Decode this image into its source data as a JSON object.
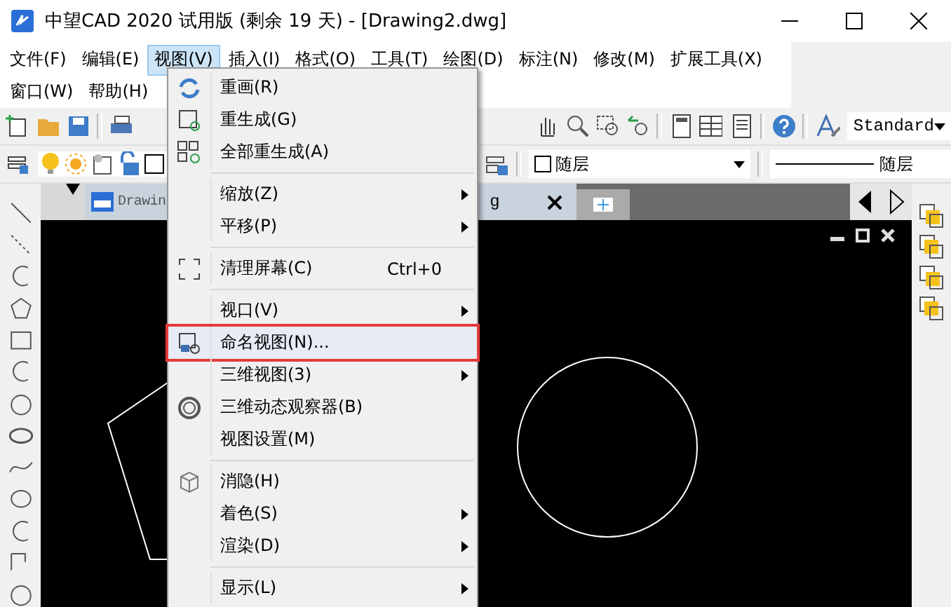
{
  "window": {
    "title": "中望CAD 2020 试用版 (剩余 19 天) - [Drawing2.dwg]"
  },
  "menubar": [
    {
      "label": "文件(F)",
      "selected": false
    },
    {
      "label": "编辑(E)",
      "selected": false
    },
    {
      "label": "视图(V)",
      "selected": true
    },
    {
      "label": "插入(I)",
      "selected": false
    },
    {
      "label": "格式(O)",
      "selected": false
    },
    {
      "label": "工具(T)",
      "selected": false
    },
    {
      "label": "绘图(D)",
      "selected": false
    },
    {
      "label": "标注(N)",
      "selected": false
    },
    {
      "label": "修改(M)",
      "selected": false
    },
    {
      "label": "扩展工具(X)",
      "selected": false
    },
    {
      "label": "窗口(W)",
      "selected": false
    },
    {
      "label": "帮助(H)",
      "selected": false
    }
  ],
  "toolbar": {
    "text_style": "Standard",
    "layer": "随层",
    "linetype": "随层"
  },
  "document_tab": {
    "label_start": "Drawin",
    "label_end": "g"
  },
  "view_menu": [
    {
      "kind": "item",
      "label": "重画(R)",
      "submenu": false,
      "selected": false
    },
    {
      "kind": "item",
      "label": "重生成(G)",
      "submenu": false,
      "selected": false
    },
    {
      "kind": "item",
      "label": "全部重生成(A)",
      "submenu": false,
      "selected": false
    },
    {
      "kind": "separator"
    },
    {
      "kind": "item",
      "label": "缩放(Z)",
      "submenu": true,
      "selected": false
    },
    {
      "kind": "item",
      "label": "平移(P)",
      "submenu": true,
      "selected": false
    },
    {
      "kind": "separator"
    },
    {
      "kind": "item",
      "label": "清理屏幕(C)",
      "shortcut": "Ctrl+0",
      "submenu": false,
      "selected": false
    },
    {
      "kind": "separator"
    },
    {
      "kind": "item",
      "label": "视口(V)",
      "submenu": true,
      "selected": false
    },
    {
      "kind": "item",
      "label": "命名视图(N)...",
      "submenu": false,
      "selected": true
    },
    {
      "kind": "item",
      "label": "三维视图(3)",
      "submenu": true,
      "selected": false
    },
    {
      "kind": "item",
      "label": "三维动态观察器(B)",
      "submenu": false,
      "selected": false
    },
    {
      "kind": "item",
      "label": "视图设置(M)",
      "submenu": false,
      "selected": false
    },
    {
      "kind": "separator"
    },
    {
      "kind": "item",
      "label": "消隐(H)",
      "submenu": false,
      "selected": false
    },
    {
      "kind": "item",
      "label": "着色(S)",
      "submenu": true,
      "selected": false
    },
    {
      "kind": "item",
      "label": "渲染(D)",
      "submenu": true,
      "selected": false
    },
    {
      "kind": "separator"
    },
    {
      "kind": "item",
      "label": "显示(L)",
      "submenu": true,
      "selected": false
    }
  ]
}
